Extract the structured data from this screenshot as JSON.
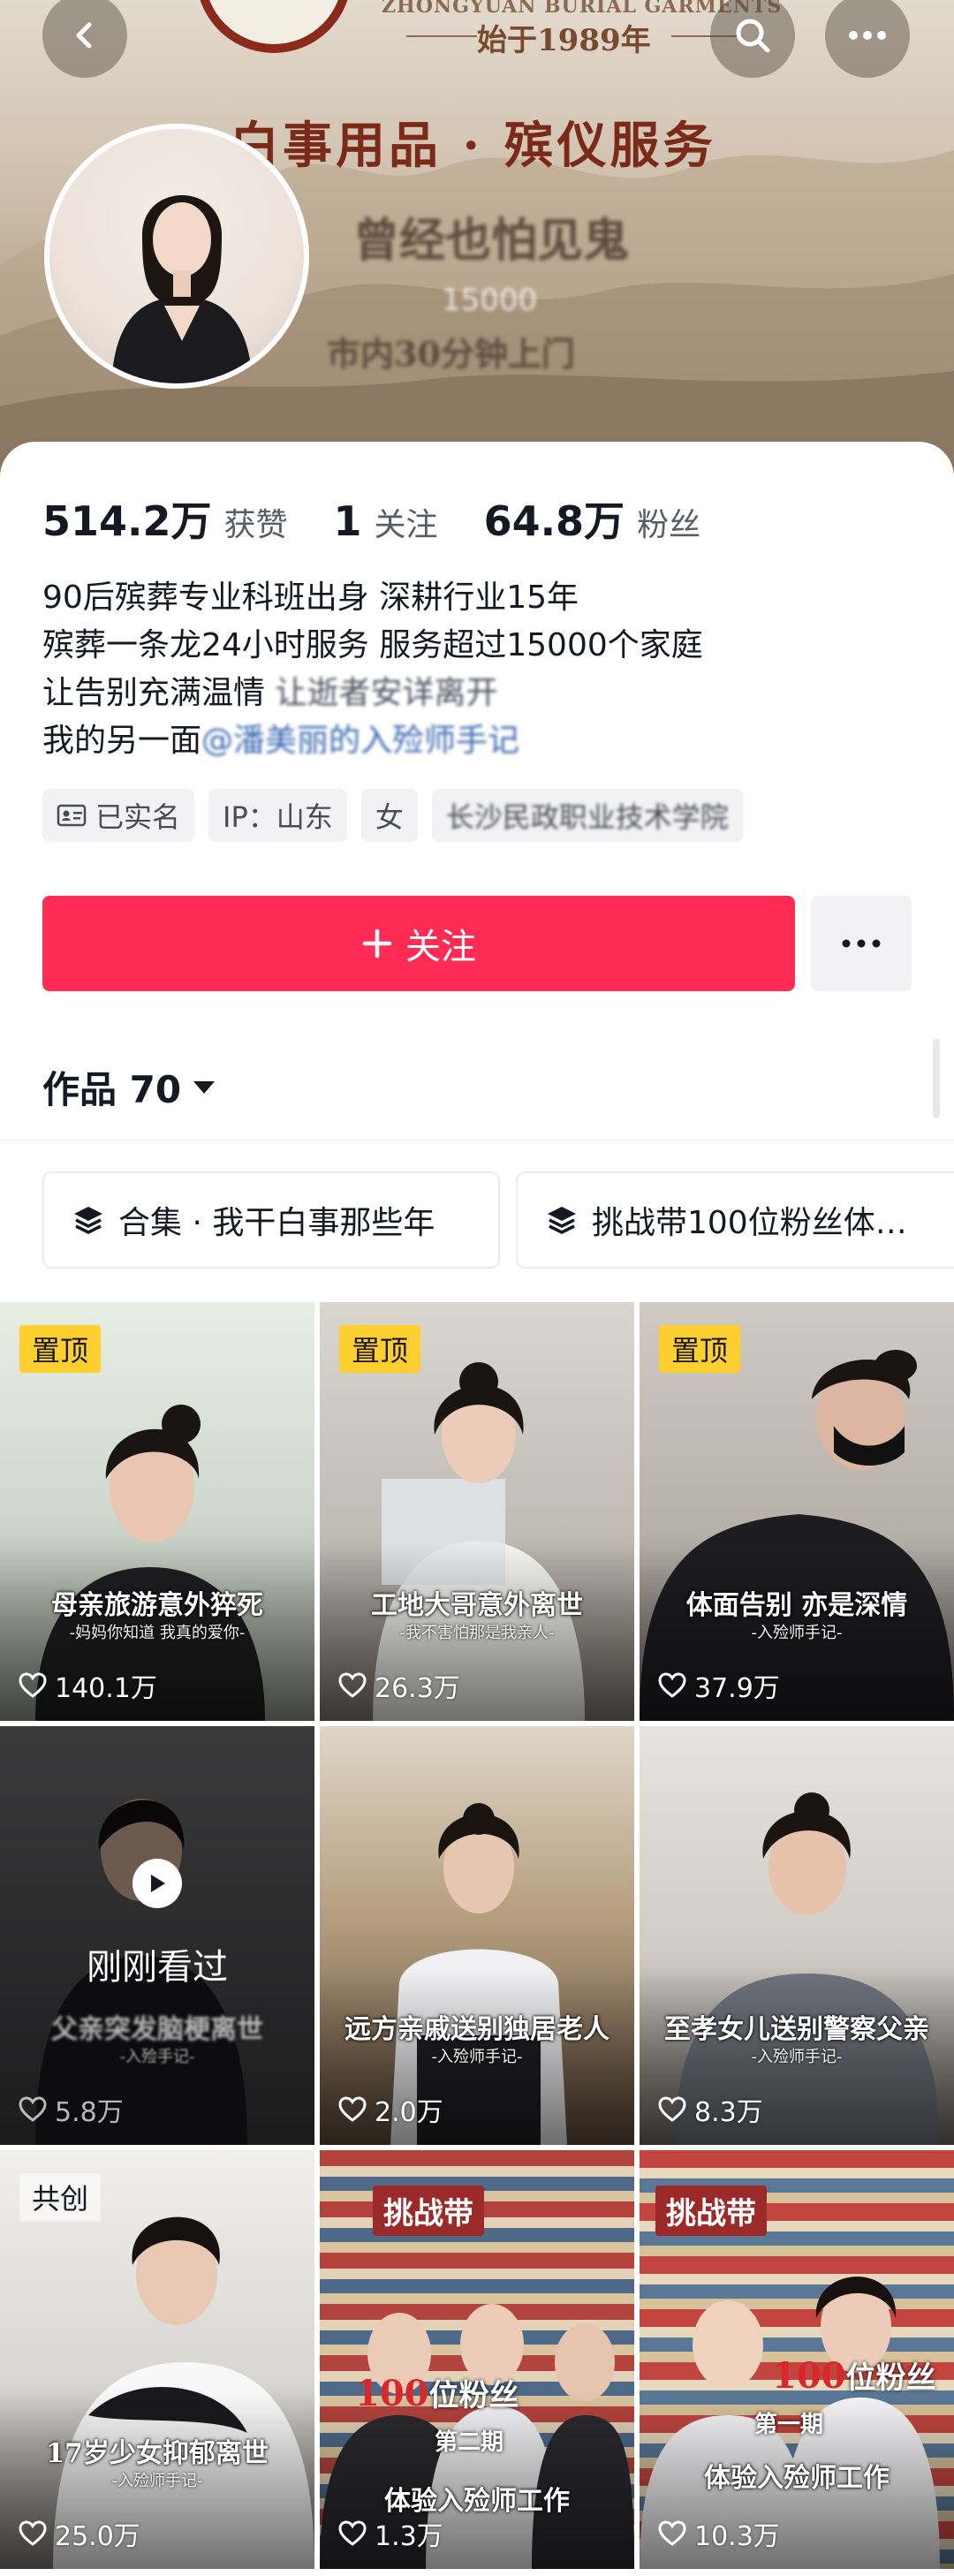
{
  "banner": {
    "brand_en": "ZHONGYUAN BURIAL GARMENTS",
    "brand_cn": "始于1989年",
    "title": "白事用品 · 殡仪服务",
    "blur_line_1": "曾经也怕见鬼",
    "blur_line_2": "15000",
    "blur_line_3": "市内30分钟上门"
  },
  "nav": {
    "back_icon": "chevron-left-icon",
    "search_icon": "search-icon",
    "more_icon": "more-dots-icon"
  },
  "profile": {
    "stats": [
      {
        "value": "514.2万",
        "label": "获赞"
      },
      {
        "value": "1",
        "label": "关注"
      },
      {
        "value": "64.8万",
        "label": "粉丝"
      }
    ],
    "bio": {
      "line1": "90后殡葬专业科班出身 深耕行业15年",
      "line2": "殡葬一条龙24小时服务 服务超过15000个家庭",
      "line3_a": "让告别充满温情 ",
      "line3_b": "让逝者安详离开",
      "line4_a": "我的另一面",
      "line4_b": "@潘美丽的入殓师手记"
    },
    "tags": {
      "verified": "已实名",
      "ip": "IP：山东",
      "gender": "女",
      "school": "长沙民政职业技术学院"
    },
    "follow_label": "关注",
    "works_label": "作品 70"
  },
  "collections": [
    {
      "label": "合集 · 我干白事那些年"
    },
    {
      "label": "挑战带100位粉丝体…"
    }
  ],
  "videos": [
    {
      "badge": "置顶",
      "caption": "母亲旅游意外猝死",
      "sub": "-妈妈你知道 我真的爱你-",
      "likes": "140.1万"
    },
    {
      "badge": "置顶",
      "caption": "工地大哥意外离世",
      "sub": "-我不害怕那是我亲人-",
      "likes": "26.3万"
    },
    {
      "badge": "置顶",
      "caption": "体面告别 亦是深情",
      "sub": "-入殓师手记-",
      "likes": "37.9万"
    },
    {
      "watched": "刚刚看过",
      "caption": "父亲突发脑梗离世",
      "sub": "-入殓手记-",
      "likes": "5.8万"
    },
    {
      "caption": "远方亲戚送别独居老人",
      "sub": "-入殓师手记-",
      "likes": "2.0万"
    },
    {
      "caption": "至孝女儿送别警察父亲",
      "sub": "-入殓师手记-",
      "likes": "8.3万"
    },
    {
      "badge": "共创",
      "caption": "17岁少女抑郁离世",
      "sub": "-入殓师手记-",
      "likes": "25.0万"
    },
    {
      "challenge": "挑战带",
      "fans_num": "100",
      "fans_txt": "位粉丝",
      "issue": "第二期",
      "caption": "体验入殓师工作",
      "likes": "1.3万"
    },
    {
      "challenge": "挑战带",
      "fans_num": "100",
      "fans_txt": "位粉丝",
      "issue": "第一期",
      "caption": "体验入殓师工作",
      "likes": "10.3万"
    }
  ],
  "colors": {
    "accent": "#fe2c55",
    "pin_badge": "#fecf2f",
    "mention": "#3d6bb3"
  }
}
